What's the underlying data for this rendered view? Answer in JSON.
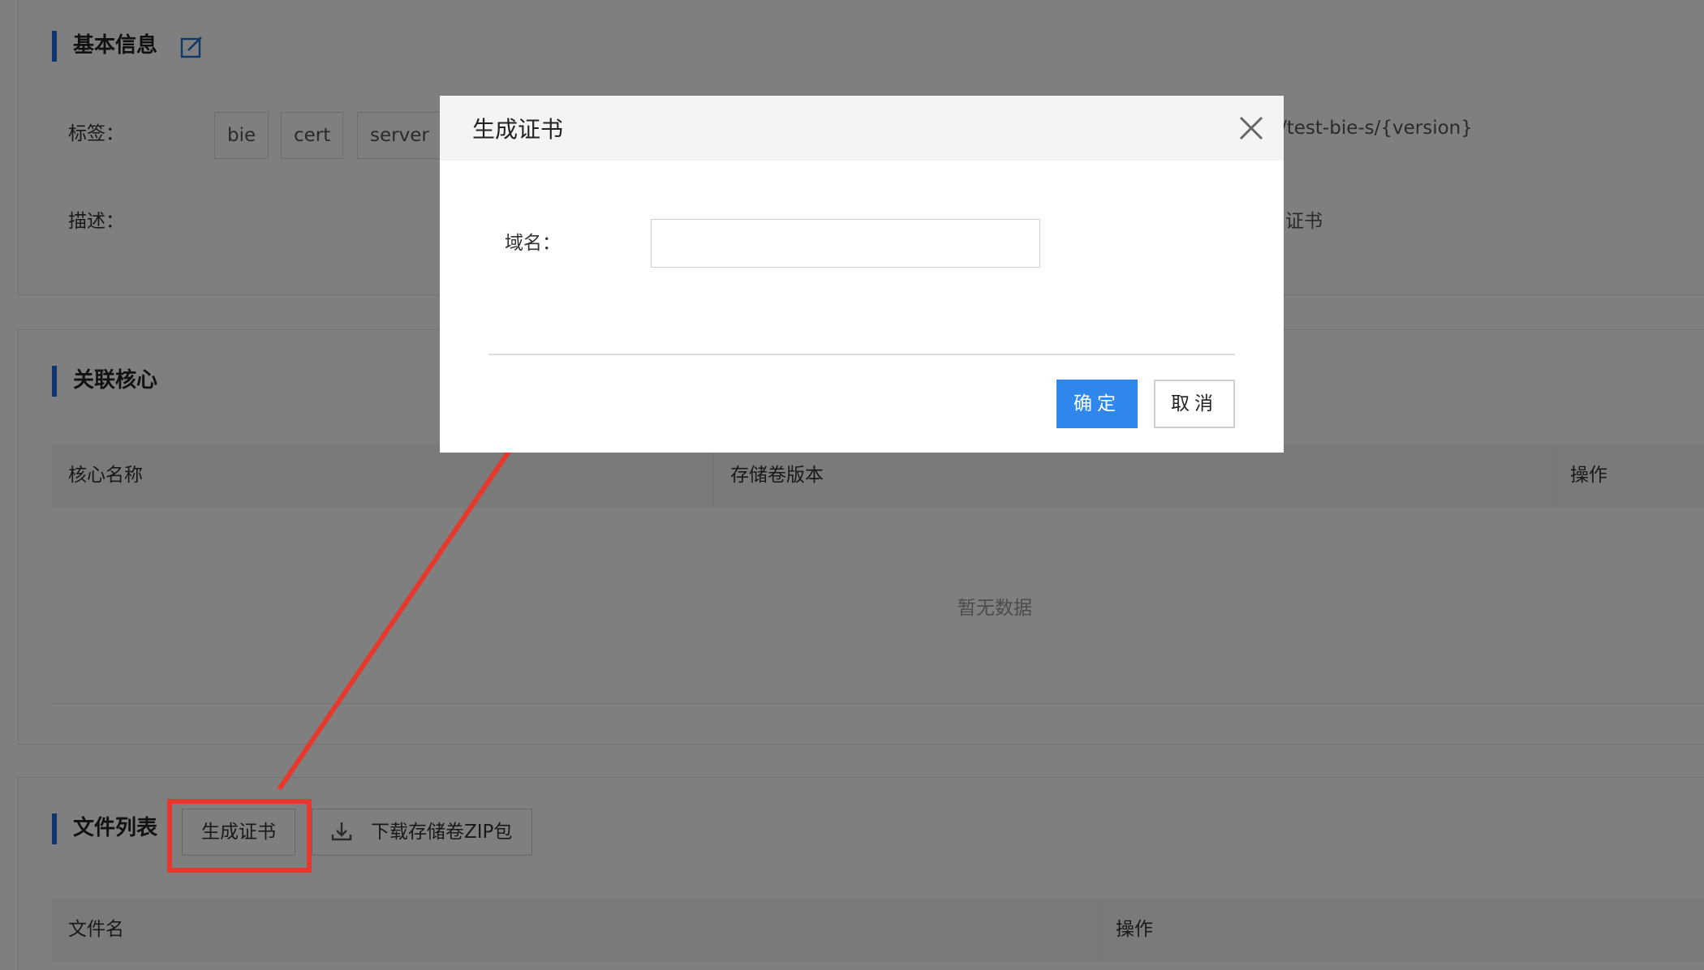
{
  "basic_info": {
    "title": "基本信息",
    "tags_label": "标签：",
    "tags": [
      "bie",
      "cert",
      "server"
    ],
    "desc_label": "描述：",
    "right_value_top": "/test-bie-s/{version}",
    "right_value_bottom": "证书"
  },
  "core_section": {
    "title": "关联核心",
    "columns": [
      "核心名称",
      "存储卷版本",
      "操作"
    ],
    "empty_text": "暂无数据"
  },
  "file_section": {
    "title": "文件列表",
    "generate_button": "生成证书",
    "download_button": "下载存储卷ZIP包",
    "columns": [
      "文件名",
      "操作"
    ]
  },
  "modal": {
    "title": "生成证书",
    "domain_label": "域名：",
    "domain_value": "",
    "confirm": "确定",
    "cancel": "取消"
  },
  "colors": {
    "accent": "#2f86eb",
    "section_bar": "#1e6fd6",
    "annotation": "#e5392e"
  }
}
